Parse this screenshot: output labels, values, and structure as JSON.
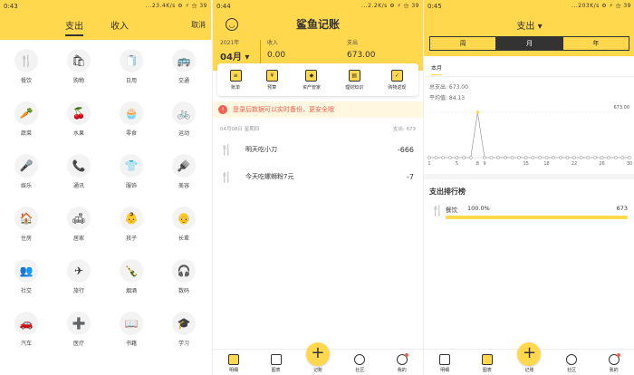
{
  "screen1": {
    "status_time": "0:43",
    "status_right": "...23.4K/s ⚙ ⚡ ⚝ 39",
    "tabs": [
      "支出",
      "收入"
    ],
    "cancel": "取消",
    "categories": [
      {
        "label": "餐饮",
        "glyph": "🍴",
        "icon": "cutlery-icon"
      },
      {
        "label": "购物",
        "glyph": "🛍",
        "icon": "shopping-bag-icon"
      },
      {
        "label": "日用",
        "glyph": "🧻",
        "icon": "tissue-icon"
      },
      {
        "label": "交通",
        "glyph": "🚌",
        "icon": "bus-icon"
      },
      {
        "label": "蔬菜",
        "glyph": "🥕",
        "icon": "carrot-icon"
      },
      {
        "label": "水果",
        "glyph": "🍒",
        "icon": "cherry-icon"
      },
      {
        "label": "零食",
        "glyph": "🧁",
        "icon": "cupcake-icon"
      },
      {
        "label": "运动",
        "glyph": "🚲",
        "icon": "bicycle-icon"
      },
      {
        "label": "娱乐",
        "glyph": "🎤",
        "icon": "microphone-icon"
      },
      {
        "label": "通讯",
        "glyph": "📞",
        "icon": "phone-icon"
      },
      {
        "label": "服饰",
        "glyph": "👕",
        "icon": "shirt-icon"
      },
      {
        "label": "美容",
        "glyph": "🪮",
        "icon": "brush-icon"
      },
      {
        "label": "住房",
        "glyph": "🏠",
        "icon": "house-icon"
      },
      {
        "label": "居家",
        "glyph": "🛋",
        "icon": "sofa-icon"
      },
      {
        "label": "孩子",
        "glyph": "👶",
        "icon": "baby-icon"
      },
      {
        "label": "长辈",
        "glyph": "👴",
        "icon": "elder-icon"
      },
      {
        "label": "社交",
        "glyph": "👥",
        "icon": "social-icon"
      },
      {
        "label": "旅行",
        "glyph": "✈",
        "icon": "airplane-icon"
      },
      {
        "label": "烟酒",
        "glyph": "🍾",
        "icon": "bottle-icon"
      },
      {
        "label": "数码",
        "glyph": "🎧",
        "icon": "headphones-icon"
      },
      {
        "label": "汽车",
        "glyph": "🚗",
        "icon": "car-icon"
      },
      {
        "label": "医疗",
        "glyph": "➕",
        "icon": "medical-icon"
      },
      {
        "label": "书籍",
        "glyph": "📖",
        "icon": "book-icon"
      },
      {
        "label": "学习",
        "glyph": "🎓",
        "icon": "graduation-cap-icon"
      }
    ]
  },
  "screen2": {
    "status_time": "0:44",
    "status_right": "...2.2K/s ⚙ ⚡ ⚝ 39",
    "title": "鲨鱼记账",
    "year": "2021年",
    "month": "04月 ▾",
    "income_label": "收入",
    "income_value": "0.00",
    "expense_label": "支出",
    "expense_value": "673.00",
    "tools": [
      {
        "label": "账单",
        "glyph": "≡",
        "icon": "bill-icon"
      },
      {
        "label": "预算",
        "glyph": "¥",
        "icon": "budget-icon"
      },
      {
        "label": "资产管家",
        "glyph": "◆",
        "icon": "asset-icon"
      },
      {
        "label": "理财知识",
        "glyph": "▤",
        "icon": "knowledge-icon"
      },
      {
        "label": "购物返现",
        "glyph": "✓",
        "icon": "cashback-icon"
      }
    ],
    "warning": "登录后数据可以实时备份，更安全哦",
    "day_label": "04月08日 星期四",
    "day_total": "支出: 673",
    "records": [
      {
        "name": "明天吃小刀",
        "amount": "-666"
      },
      {
        "name": "今天吃螺蛳粉7元",
        "amount": "-7"
      }
    ],
    "tabbar": [
      "明细",
      "图表",
      "记账",
      "社区",
      "我的"
    ]
  },
  "screen3": {
    "status_time": "0:45",
    "status_right": "...203K/s ⚙ ⚡ ⚝ 39",
    "title": "支出 ▾",
    "segments": [
      "周",
      "月",
      "年"
    ],
    "active_segment": 1,
    "period": "本月",
    "total": "总支出: 673.00",
    "average": "平均值: 84.13",
    "rank_title": "支出排行榜",
    "rank": [
      {
        "name": "餐饮",
        "percent": "100.0%",
        "value": "673"
      }
    ],
    "tabbar": [
      "明细",
      "图表",
      "记账",
      "社区",
      "我的"
    ]
  },
  "chart_data": {
    "type": "line",
    "x": [
      1,
      2,
      3,
      4,
      5,
      6,
      7,
      8,
      9,
      10,
      11,
      12,
      13,
      14,
      15,
      16,
      17,
      18,
      19,
      20,
      21,
      22,
      23,
      24,
      25,
      26,
      27,
      28,
      29,
      30
    ],
    "values": [
      0,
      0,
      0,
      0,
      0,
      0,
      0,
      673,
      0,
      0,
      0,
      0,
      0,
      0,
      0,
      0,
      0,
      0,
      0,
      0,
      0,
      0,
      0,
      0,
      0,
      0,
      0,
      0,
      0,
      0
    ],
    "x_tick_labels": [
      "1",
      "5",
      "8",
      "9",
      "15",
      "18",
      "22",
      "26",
      "30"
    ],
    "x_tick_positions": [
      1,
      5,
      8,
      9,
      15,
      18,
      22,
      26,
      30
    ],
    "max_label": "673.00",
    "ylim": [
      0,
      673
    ],
    "accent": "#FFD84D"
  }
}
